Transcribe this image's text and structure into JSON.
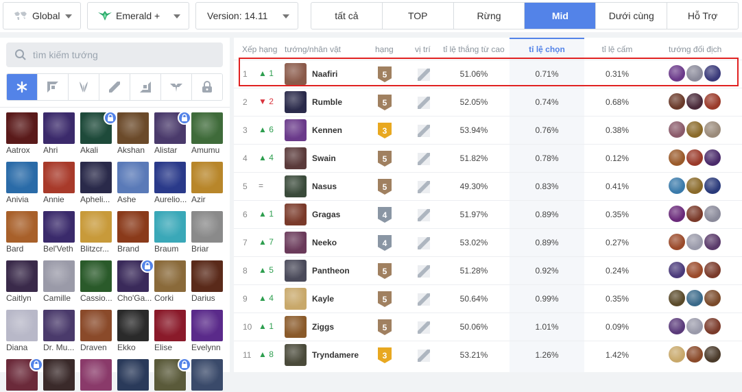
{
  "filters": {
    "region": "Global",
    "rank": "Emerald +",
    "version": "Version: 14.11"
  },
  "tabs": [
    {
      "label": "tất cả",
      "active": false
    },
    {
      "label": "TOP",
      "active": false
    },
    {
      "label": "Rừng",
      "active": false
    },
    {
      "label": "Mid",
      "active": true
    },
    {
      "label": "Dưới cùng",
      "active": false
    },
    {
      "label": "Hỗ Trợ",
      "active": false
    }
  ],
  "sidebar": {
    "search_placeholder": "tìm kiếm tướng",
    "roles": [
      "all-icon",
      "top-icon",
      "jungle-icon",
      "mid-icon",
      "bottom-icon",
      "support-icon",
      "locked-icon"
    ],
    "champions": [
      {
        "name": "Aatrox",
        "color": "#5a1a1a",
        "locked": false
      },
      {
        "name": "Ahri",
        "color": "#3b2a6b",
        "locked": false
      },
      {
        "name": "Akali",
        "color": "#1e4a3a",
        "locked": true
      },
      {
        "name": "Akshan",
        "color": "#6b4a2a",
        "locked": false
      },
      {
        "name": "Alistar",
        "color": "#4a3a6b",
        "locked": true
      },
      {
        "name": "Amumu",
        "color": "#3f6b3a",
        "locked": false
      },
      {
        "name": "Anivia",
        "color": "#2a6ba8",
        "locked": false
      },
      {
        "name": "Annie",
        "color": "#a83a2a",
        "locked": false
      },
      {
        "name": "Apheli...",
        "color": "#2a2a4a",
        "locked": false
      },
      {
        "name": "Ashe",
        "color": "#5a7ab8",
        "locked": false
      },
      {
        "name": "Aurelio...",
        "color": "#2a3a8a",
        "locked": false
      },
      {
        "name": "Azir",
        "color": "#b8862a",
        "locked": false
      },
      {
        "name": "Bard",
        "color": "#a8602a",
        "locked": false
      },
      {
        "name": "Bel'Veth",
        "color": "#3a2a6b",
        "locked": false
      },
      {
        "name": "Blitzcr...",
        "color": "#c89a3a",
        "locked": false
      },
      {
        "name": "Brand",
        "color": "#8a3a1a",
        "locked": false
      },
      {
        "name": "Braum",
        "color": "#3aa8b8",
        "locked": false
      },
      {
        "name": "Briar",
        "color": "#8a8a8a",
        "locked": false
      },
      {
        "name": "Caitlyn",
        "color": "#3a2a4a",
        "locked": false
      },
      {
        "name": "Camille",
        "color": "#9a9aa8",
        "locked": false
      },
      {
        "name": "Cassio...",
        "color": "#2a5a2a",
        "locked": false
      },
      {
        "name": "Cho'Ga...",
        "color": "#3a2a5a",
        "locked": true
      },
      {
        "name": "Corki",
        "color": "#8a6a3a",
        "locked": false
      },
      {
        "name": "Darius",
        "color": "#5a2a1a",
        "locked": false
      },
      {
        "name": "Diana",
        "color": "#b8b8c8",
        "locked": false
      },
      {
        "name": "Dr. Mu...",
        "color": "#4a3a6b",
        "locked": false
      },
      {
        "name": "Draven",
        "color": "#8a4a2a",
        "locked": false
      },
      {
        "name": "Ekko",
        "color": "#2a2a2a",
        "locked": false
      },
      {
        "name": "Elise",
        "color": "#8a1a2a",
        "locked": false
      },
      {
        "name": "Evelynn",
        "color": "#5a2a8a",
        "locked": false
      },
      {
        "name": "",
        "color": "#6b2a3a",
        "locked": true
      },
      {
        "name": "",
        "color": "#3a2a2a",
        "locked": false
      },
      {
        "name": "",
        "color": "#8a3a6a",
        "locked": false
      },
      {
        "name": "",
        "color": "#2a3a5a",
        "locked": false
      },
      {
        "name": "",
        "color": "#5a5a3a",
        "locked": true
      },
      {
        "name": "",
        "color": "#3a4a6a",
        "locked": false
      }
    ]
  },
  "table": {
    "headers": {
      "rank": "Xếp hạng",
      "champion": "tướng/nhân vật",
      "tier": "hạng",
      "position": "vị trí",
      "winrate": "tỉ lệ thắng từ cao",
      "pickrate": "tỉ lệ chọn",
      "banrate": "tỉ lệ cấm",
      "counters": "tướng đối địch"
    },
    "rows": [
      {
        "rank": "1",
        "change": "▲ 1",
        "dir": "up",
        "name": "Naafiri",
        "tier": "5",
        "tier_color": "#a08060",
        "winrate": "51.06%",
        "pickrate": "0.71%",
        "banrate": "0.31%",
        "av": "#8a5a4a",
        "counters": [
          "#6b3a8a",
          "#8a8a9a",
          "#3a3a7a"
        ]
      },
      {
        "rank": "2",
        "change": "▼ 2",
        "dir": "dn",
        "name": "Rumble",
        "tier": "5",
        "tier_color": "#a08060",
        "winrate": "52.05%",
        "pickrate": "0.74%",
        "banrate": "0.68%",
        "av": "#2a2a4a",
        "counters": [
          "#6a3a2a",
          "#4a2a3a",
          "#9a3a2a"
        ]
      },
      {
        "rank": "3",
        "change": "▲ 6",
        "dir": "up",
        "name": "Kennen",
        "tier": "3",
        "tier_color": "#e8a820",
        "winrate": "53.94%",
        "pickrate": "0.76%",
        "banrate": "0.38%",
        "av": "#6a3a8a",
        "counters": [
          "#8a5a6a",
          "#8a6a2a",
          "#9a8a7a"
        ]
      },
      {
        "rank": "4",
        "change": "▲ 4",
        "dir": "up",
        "name": "Swain",
        "tier": "5",
        "tier_color": "#a08060",
        "winrate": "51.82%",
        "pickrate": "0.78%",
        "banrate": "0.12%",
        "av": "#5a3a3a",
        "counters": [
          "#9a5a2a",
          "#9a3a2a",
          "#4a2a6a"
        ]
      },
      {
        "rank": "5",
        "change": "=",
        "dir": "eq",
        "name": "Nasus",
        "tier": "5",
        "tier_color": "#a08060",
        "winrate": "49.30%",
        "pickrate": "0.83%",
        "banrate": "0.41%",
        "av": "#3a4a3a",
        "counters": [
          "#3a7aaa",
          "#8a6a2a",
          "#2a3a7a"
        ]
      },
      {
        "rank": "6",
        "change": "▲ 1",
        "dir": "up",
        "name": "Gragas",
        "tier": "4",
        "tier_color": "#8a96a4",
        "winrate": "51.97%",
        "pickrate": "0.89%",
        "banrate": "0.35%",
        "av": "#7a3a2a",
        "counters": [
          "#6a2a7a",
          "#7a3a2a",
          "#8a8a9a"
        ]
      },
      {
        "rank": "7",
        "change": "▲ 7",
        "dir": "up",
        "name": "Neeko",
        "tier": "4",
        "tier_color": "#8a96a4",
        "winrate": "53.02%",
        "pickrate": "0.89%",
        "banrate": "0.27%",
        "av": "#6a3a5a",
        "counters": [
          "#9a4a2a",
          "#9a9aaa",
          "#5a3a6a"
        ]
      },
      {
        "rank": "8",
        "change": "▲ 5",
        "dir": "up",
        "name": "Pantheon",
        "tier": "5",
        "tier_color": "#a08060",
        "winrate": "51.28%",
        "pickrate": "0.92%",
        "banrate": "0.24%",
        "av": "#4a4a5a",
        "counters": [
          "#4a3a7a",
          "#9a4a2a",
          "#7a3a2a"
        ]
      },
      {
        "rank": "9",
        "change": "▲ 4",
        "dir": "up",
        "name": "Kayle",
        "tier": "5",
        "tier_color": "#a08060",
        "winrate": "50.64%",
        "pickrate": "0.99%",
        "banrate": "0.35%",
        "av": "#c8a86a",
        "counters": [
          "#5a4a2a",
          "#3a6a8a",
          "#7a4a2a"
        ]
      },
      {
        "rank": "10",
        "change": "▲ 1",
        "dir": "up",
        "name": "Ziggs",
        "tier": "5",
        "tier_color": "#a08060",
        "winrate": "50.06%",
        "pickrate": "1.01%",
        "banrate": "0.09%",
        "av": "#8a5a2a",
        "counters": [
          "#5a3a7a",
          "#9a9aaa",
          "#7a3a2a"
        ]
      },
      {
        "rank": "11",
        "change": "▲ 8",
        "dir": "up",
        "name": "Tryndamere",
        "tier": "3",
        "tier_color": "#e8a820",
        "winrate": "53.21%",
        "pickrate": "1.26%",
        "banrate": "1.42%",
        "av": "#4a4a3a",
        "counters": [
          "#c8a86a",
          "#8a4a2a",
          "#4a3a2a"
        ]
      }
    ]
  }
}
